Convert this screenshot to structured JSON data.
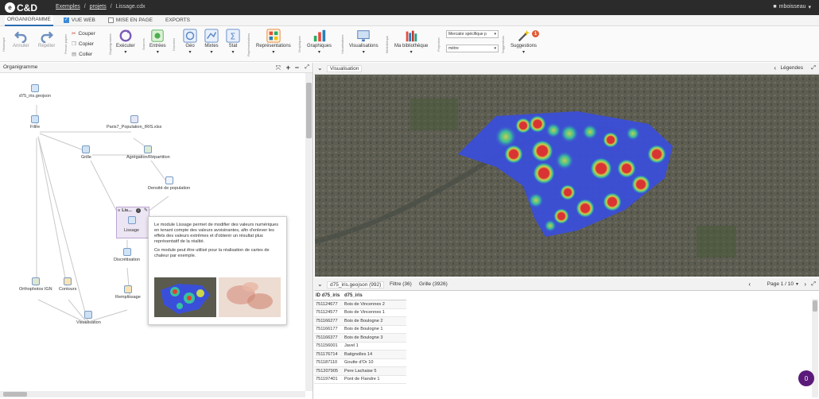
{
  "app": {
    "logo": "C&D",
    "logo_mark": "e"
  },
  "breadcrumb": {
    "exemples": "Exemples",
    "sep": "/",
    "projets": "projets",
    "file": "Lissage.cdx"
  },
  "user": {
    "icon": "user-icon",
    "name": "mboisseau",
    "caret": "▾"
  },
  "tabs": [
    {
      "label": "ORGANIGRAMME",
      "active": true
    },
    {
      "label": "VUE WEB",
      "checked": true
    },
    {
      "label": "MISE EN PAGE",
      "checked": false
    },
    {
      "label": "EXPORTS"
    }
  ],
  "ribbon": {
    "group_labels": [
      "Historique",
      "Presse-papier",
      "Organigramme",
      "Sources",
      "Données",
      "Représentations",
      "Graphiques",
      "Visualisations",
      "Bibliothèque",
      "Projection",
      "Suggestions"
    ],
    "annuler": "Annuler",
    "repeter": "Répéter",
    "couper": "Couper",
    "copier": "Copier",
    "coller": "Coller",
    "executer": "Exécuter",
    "entrees": "Entrées",
    "geo": "Géo",
    "mixtes": "Mixtes",
    "stat": "Stat",
    "representations": "Représentations",
    "graphiques": "Graphiques",
    "visualisations": "Visualisations",
    "bibliotheque": "Ma bibliothèque",
    "projection": "Mercator spécifique p",
    "unit": "mètre",
    "suggestions": "Suggestions",
    "suggestions_count": "1"
  },
  "left_pane": {
    "tab": "Organigramme",
    "nodes": {
      "d75": "d75_iris.geojson",
      "filtre": "Filtre",
      "paris": "Paris7_Population_IRIS.xlsx",
      "grille": "Grille",
      "agreg": "Agrégation/Répartition",
      "densite": "Densité de population",
      "lissage": "Lissage",
      "lissage_short": "Lis...",
      "discret": "Discrétisation",
      "ortho": "Orthophotos IGN",
      "contours": "Contours",
      "remplissage": "Remplissage",
      "visu": "Visualisation"
    },
    "tooltip": {
      "p1": "Le module Lissage permet de modifier des valeurs numériques en tenant compte des valeurs avoisinantes, afin d'enlever les effets des valeurs extrêmes et d'obtenir un résultat plus représentatif de la réalité.",
      "p2": "Ce module peut être utilisé pour la réalisation de cartes de chaleur par exemple."
    }
  },
  "vis": {
    "tab": "Visualisation",
    "legendes": "Légendes"
  },
  "table_tabs": [
    {
      "label": "d75_iris.geojson (992)"
    },
    {
      "label": "Filtre (36)"
    },
    {
      "label": "Grille (3926)"
    }
  ],
  "pager": "Page 1 / 10",
  "table": {
    "headers": [
      "ID d75_iris",
      "d75_iris"
    ],
    "rows": [
      [
        "751124677",
        "Bois de Vincennes 2"
      ],
      [
        "751124577",
        "Bois de Vincennes 1"
      ],
      [
        "751166277",
        "Bois de Boulogne 2"
      ],
      [
        "751166177",
        "Bois de Boulogne 1"
      ],
      [
        "751166377",
        "Bois de Boulogne 3"
      ],
      [
        "751156001",
        "Javel 1"
      ],
      [
        "751176714",
        "Batignolles 14"
      ],
      [
        "751187110",
        "Goutte d'Or 10"
      ],
      [
        "751207905",
        "Pere Lachaise 5"
      ],
      [
        "751197401",
        "Pont de Flandre 1"
      ]
    ]
  },
  "notif_count": "0",
  "colors": {
    "topbar": "#2b2b2b",
    "accent": "#3b8ad9",
    "badge": "#e25b35",
    "purple": "#5b1a7a"
  }
}
